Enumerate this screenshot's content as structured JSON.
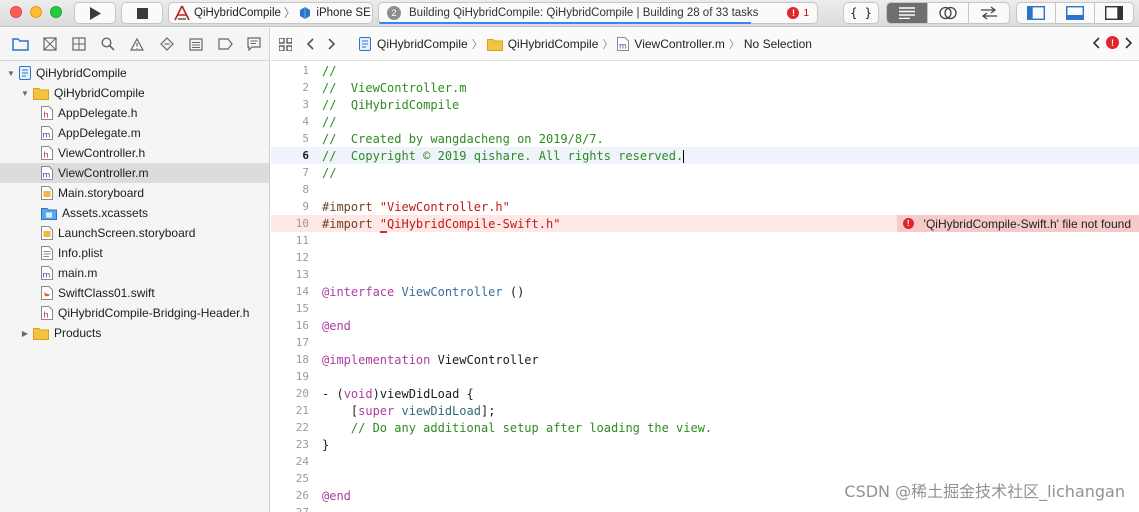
{
  "toolbar": {
    "scheme_target": "QiHybridCompile",
    "scheme_device": "iPhone SE",
    "activity_count": "2",
    "activity_status": "Building QiHybridCompile: QiHybridCompile | Building 28 of 33 tasks",
    "error_icon": "!",
    "error_count": "1",
    "progress_fraction": 0.85,
    "library_label": "{ }"
  },
  "navigator": {
    "tree": [
      {
        "label": "QiHybridCompile",
        "icon": "project-icon",
        "level": 0,
        "expanded": true
      },
      {
        "label": "QiHybridCompile",
        "icon": "folder-icon",
        "level": 1,
        "expanded": true
      },
      {
        "label": "AppDelegate.h",
        "icon": "header-file-icon",
        "level": 2
      },
      {
        "label": "AppDelegate.m",
        "icon": "objc-file-icon",
        "level": 2
      },
      {
        "label": "ViewController.h",
        "icon": "header-file-icon",
        "level": 2
      },
      {
        "label": "ViewController.m",
        "icon": "objc-file-icon",
        "level": 2,
        "selected": true
      },
      {
        "label": "Main.storyboard",
        "icon": "storyboard-icon",
        "level": 2
      },
      {
        "label": "Assets.xcassets",
        "icon": "assets-folder-icon",
        "level": 2
      },
      {
        "label": "LaunchScreen.storyboard",
        "icon": "storyboard-icon",
        "level": 2
      },
      {
        "label": "Info.plist",
        "icon": "plist-file-icon",
        "level": 2
      },
      {
        "label": "main.m",
        "icon": "objc-file-icon",
        "level": 2
      },
      {
        "label": "SwiftClass01.swift",
        "icon": "swift-file-icon",
        "level": 2
      },
      {
        "label": "QiHybridCompile-Bridging-Header.h",
        "icon": "header-file-icon",
        "level": 2
      },
      {
        "label": "Products",
        "icon": "folder-icon",
        "level": 1,
        "expanded": false
      }
    ]
  },
  "jumpbar": {
    "project": "QiHybridCompile",
    "group": "QiHybridCompile",
    "file": "ViewController.m",
    "symbol": "No Selection",
    "error_icon": "!"
  },
  "editor": {
    "current_line": 6,
    "error_line": 10,
    "error_message": "'QiHybridCompile-Swift.h' file not found",
    "error_icon": "!",
    "lines": [
      {
        "n": "1",
        "tokens": [
          [
            "comment",
            "//"
          ]
        ]
      },
      {
        "n": "2",
        "tokens": [
          [
            "comment",
            "//  ViewController.m"
          ]
        ]
      },
      {
        "n": "3",
        "tokens": [
          [
            "comment",
            "//  QiHybridCompile"
          ]
        ]
      },
      {
        "n": "4",
        "tokens": [
          [
            "comment",
            "//"
          ]
        ]
      },
      {
        "n": "5",
        "tokens": [
          [
            "comment",
            "//  Created by wangdacheng on 2019/8/7."
          ]
        ]
      },
      {
        "n": "6",
        "tokens": [
          [
            "comment",
            "//  Copyright © 2019 qishare. All rights reserved."
          ]
        ]
      },
      {
        "n": "7",
        "tokens": [
          [
            "comment",
            "//"
          ]
        ]
      },
      {
        "n": "8",
        "tokens": []
      },
      {
        "n": "9",
        "tokens": [
          [
            "pp",
            "#import "
          ],
          [
            "str",
            "\"ViewController.h\""
          ]
        ]
      },
      {
        "n": "10",
        "tokens": [
          [
            "pp",
            "#import "
          ],
          [
            "strerr",
            "\""
          ],
          [
            "str",
            "QiHybridCompile-Swift.h\""
          ]
        ]
      },
      {
        "n": "11",
        "tokens": []
      },
      {
        "n": "12",
        "tokens": []
      },
      {
        "n": "13",
        "tokens": []
      },
      {
        "n": "14",
        "tokens": [
          [
            "kw",
            "@interface"
          ],
          [
            "plain",
            " "
          ],
          [
            "cls",
            "ViewController"
          ],
          [
            "plain",
            " ()"
          ]
        ]
      },
      {
        "n": "15",
        "tokens": []
      },
      {
        "n": "16",
        "tokens": [
          [
            "kw",
            "@end"
          ]
        ]
      },
      {
        "n": "17",
        "tokens": []
      },
      {
        "n": "18",
        "tokens": [
          [
            "kw",
            "@implementation"
          ],
          [
            "plain",
            " ViewController"
          ]
        ]
      },
      {
        "n": "19",
        "tokens": []
      },
      {
        "n": "20",
        "tokens": [
          [
            "plain",
            "- ("
          ],
          [
            "kw",
            "void"
          ],
          [
            "plain",
            ")viewDidLoad {"
          ]
        ]
      },
      {
        "n": "21",
        "tokens": [
          [
            "plain",
            "    ["
          ],
          [
            "kw",
            "super"
          ],
          [
            "plain",
            " "
          ],
          [
            "meth",
            "viewDidLoad"
          ],
          [
            "plain",
            "];"
          ]
        ]
      },
      {
        "n": "22",
        "tokens": [
          [
            "plain",
            "    "
          ],
          [
            "comment",
            "// Do any additional setup after loading the view."
          ]
        ]
      },
      {
        "n": "23",
        "tokens": [
          [
            "plain",
            "}"
          ]
        ]
      },
      {
        "n": "24",
        "tokens": []
      },
      {
        "n": "25",
        "tokens": []
      },
      {
        "n": "26",
        "tokens": [
          [
            "kw",
            "@end"
          ]
        ]
      },
      {
        "n": "27",
        "tokens": []
      }
    ]
  },
  "watermark": "CSDN @稀土掘金技术社区_lichangan",
  "colors": {
    "accent": "#3b83f6",
    "error": "#e0262a",
    "error_line_bg": "#fde7e7",
    "current_line_bg": "#eef3fc",
    "comment": "#2e8b20",
    "keyword": "#ad3da4",
    "string": "#c41a16",
    "preprocessor": "#6f4421"
  }
}
